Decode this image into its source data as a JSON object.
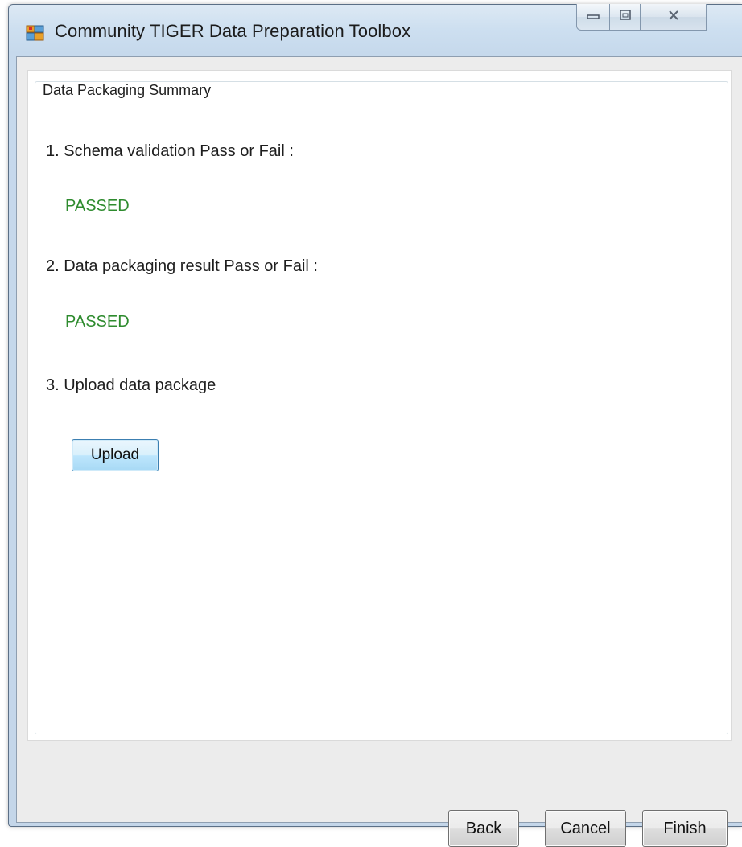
{
  "window": {
    "title": "Community TIGER Data Preparation Toolbox",
    "caption_buttons": {
      "minimize_icon": "minimize-icon",
      "maximize_icon": "maximize-icon",
      "close_icon": "close-icon"
    }
  },
  "group": {
    "title": "Data Packaging Summary"
  },
  "steps": [
    {
      "label": "1. Schema validation Pass or Fail :",
      "status": "PASSED"
    },
    {
      "label": "2. Data packaging result Pass or Fail :",
      "status": "PASSED"
    },
    {
      "label": "3. Upload data package"
    }
  ],
  "upload_button": {
    "label": "Upload"
  },
  "footer": {
    "back_label": "Back",
    "cancel_label": "Cancel",
    "finish_label": "Finish"
  },
  "colors": {
    "status_passed": "#2e8b2e",
    "accent": "#3c7fb1"
  }
}
